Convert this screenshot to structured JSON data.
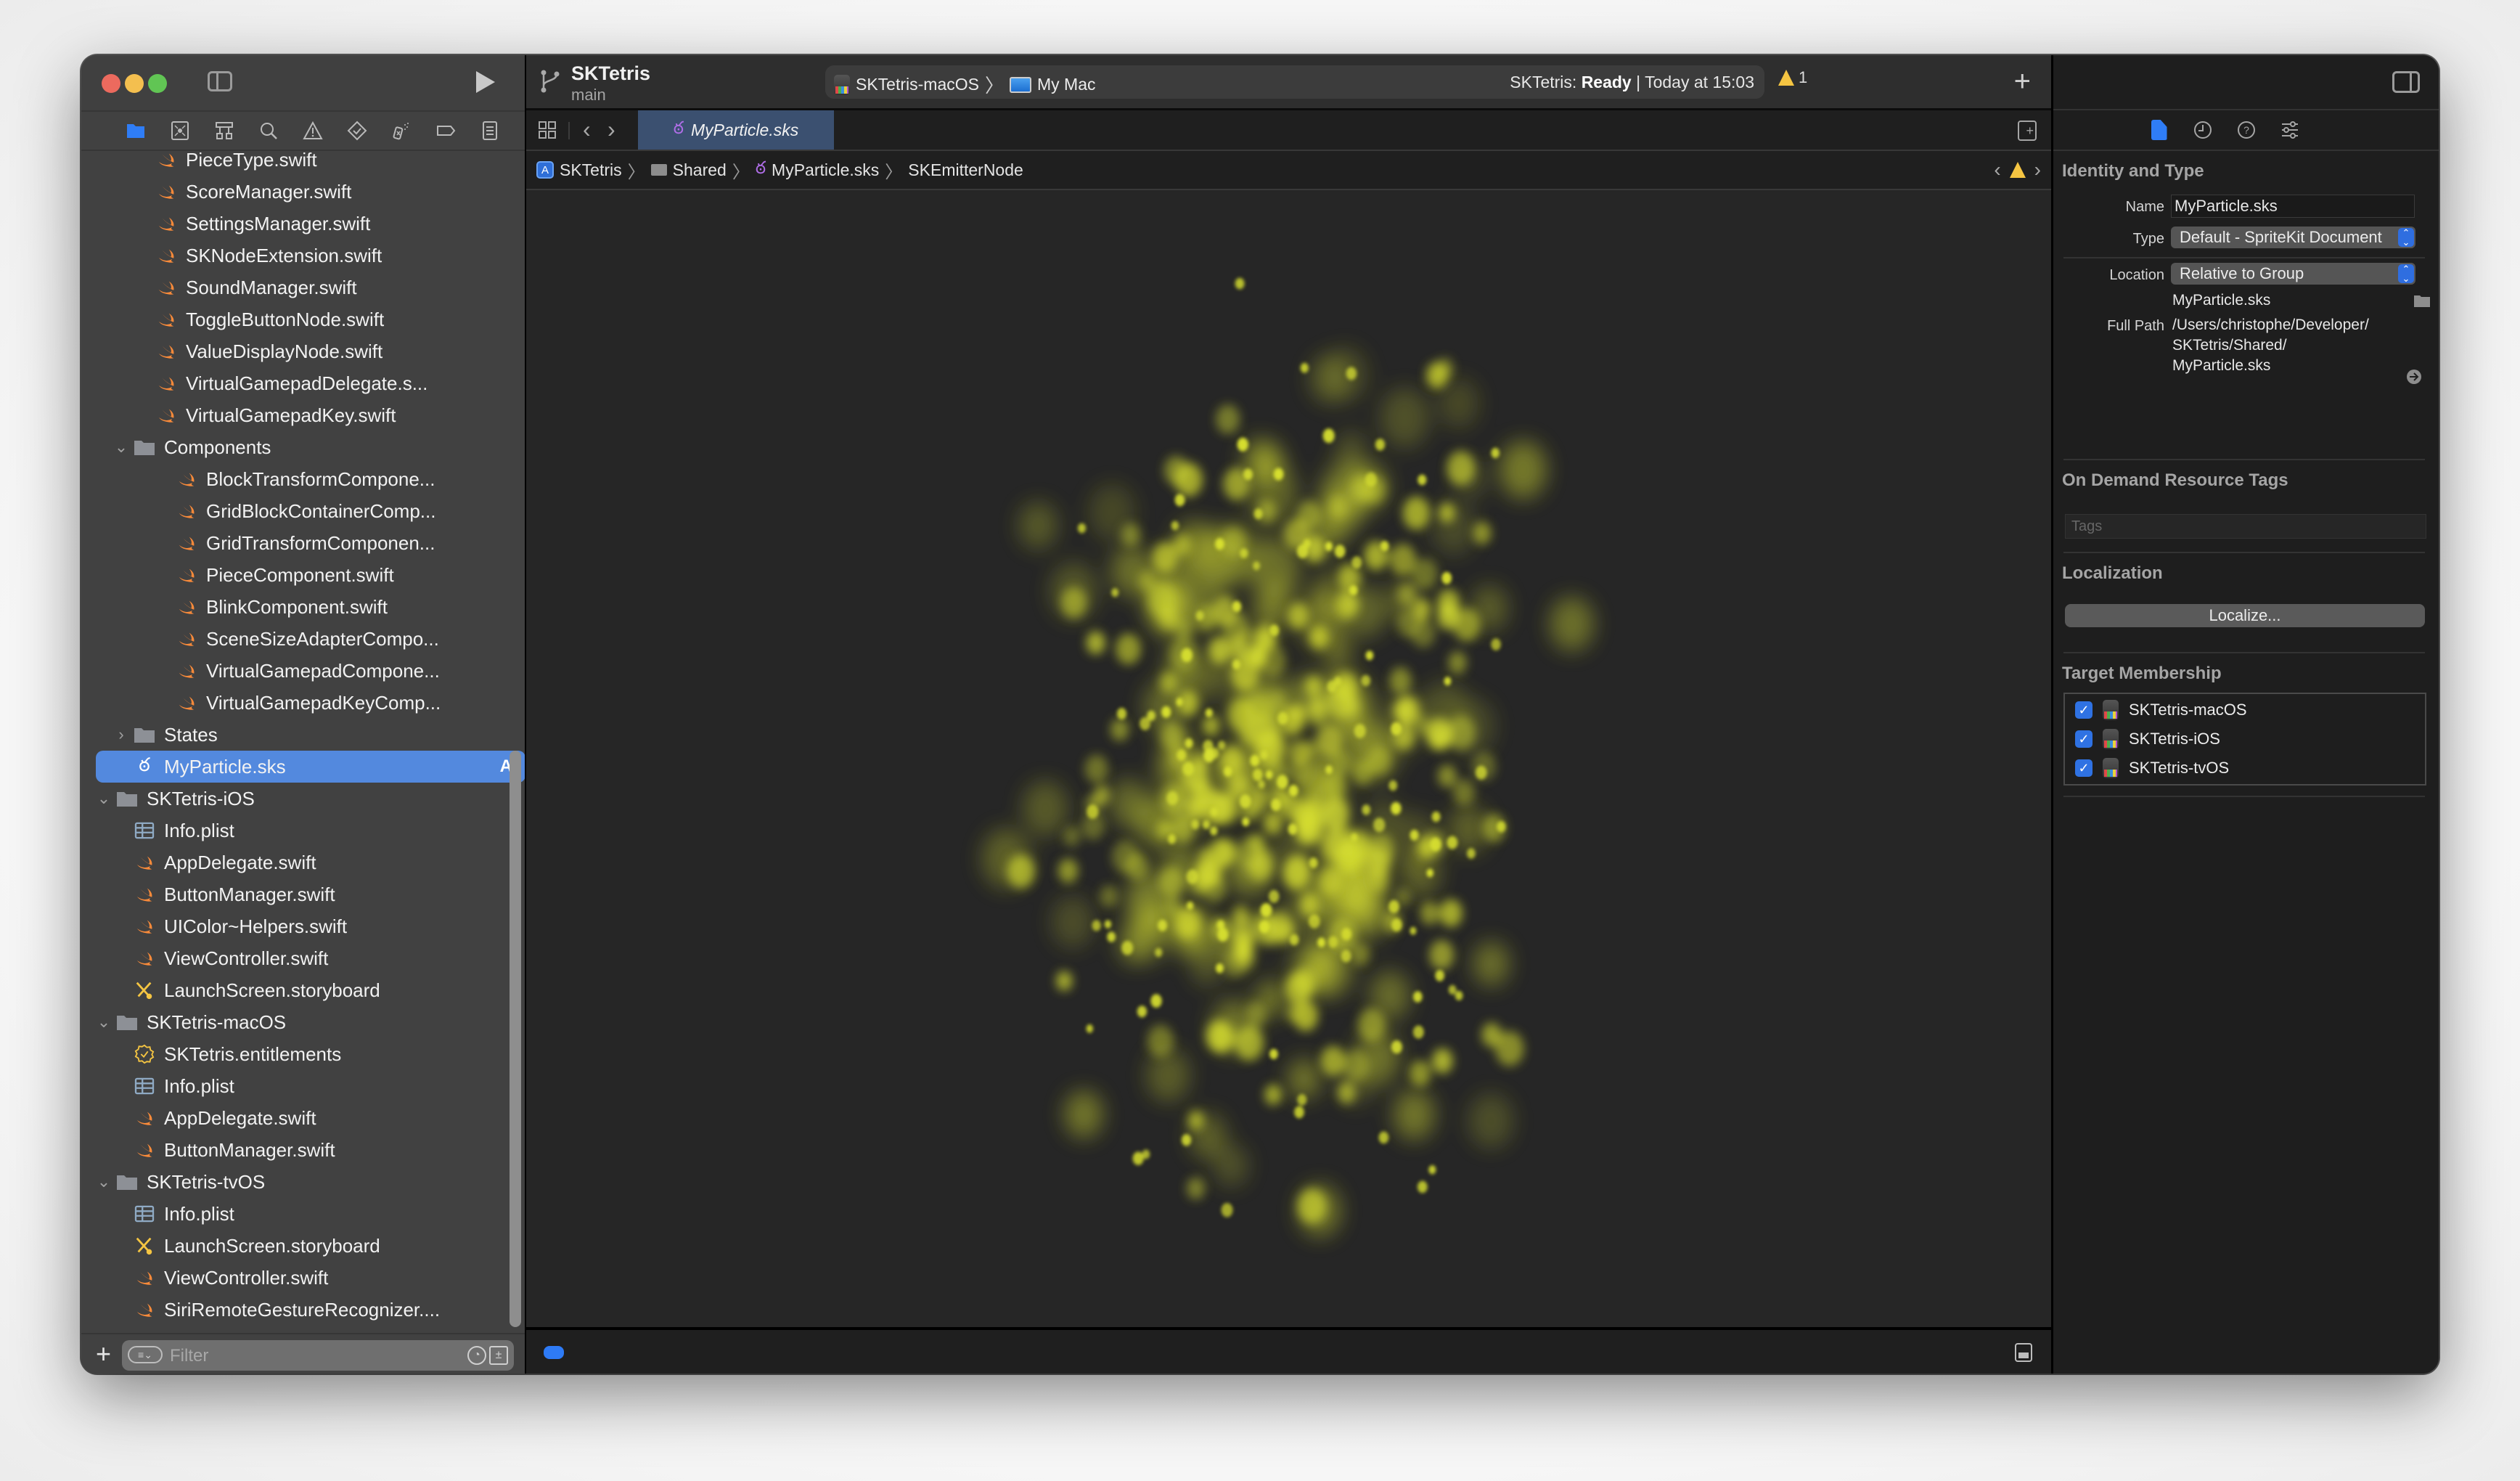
{
  "window": {
    "controls": [
      "close",
      "minimize",
      "zoom"
    ]
  },
  "toolbar": {
    "project_name": "SKTetris",
    "branch": "main",
    "scheme": "SKTetris-macOS",
    "destination": "My Mac",
    "status_project": "SKTetris:",
    "status_state": "Ready",
    "status_separator": "|",
    "status_time": "Today at 15:03",
    "warning_count": "1",
    "add_label": "+"
  },
  "navigator": {
    "tabs": [
      {
        "name": "project-navigator",
        "icon": "folder-icon",
        "active": true
      },
      {
        "name": "source-control-navigator",
        "icon": "source-control-icon"
      },
      {
        "name": "symbol-navigator",
        "icon": "hierarchy-icon"
      },
      {
        "name": "find-navigator",
        "icon": "search-icon"
      },
      {
        "name": "issue-navigator",
        "icon": "warning-icon"
      },
      {
        "name": "test-navigator",
        "icon": "diamond-check-icon"
      },
      {
        "name": "debug-navigator",
        "icon": "spray-icon"
      },
      {
        "name": "breakpoint-navigator",
        "icon": "breakpoint-icon"
      },
      {
        "name": "report-navigator",
        "icon": "list-icon"
      }
    ],
    "files": [
      {
        "label": "PieceType.swift",
        "type": "swift",
        "level": 3
      },
      {
        "label": "ScoreManager.swift",
        "type": "swift",
        "level": 3
      },
      {
        "label": "SettingsManager.swift",
        "type": "swift",
        "level": 3
      },
      {
        "label": "SKNodeExtension.swift",
        "type": "swift",
        "level": 3
      },
      {
        "label": "SoundManager.swift",
        "type": "swift",
        "level": 3
      },
      {
        "label": "ToggleButtonNode.swift",
        "type": "swift",
        "level": 3
      },
      {
        "label": "ValueDisplayNode.swift",
        "type": "swift",
        "level": 3
      },
      {
        "label": "VirtualGamepadDelegate.s...",
        "type": "swift",
        "level": 3
      },
      {
        "label": "VirtualGamepadKey.swift",
        "type": "swift",
        "level": 3
      },
      {
        "label": "Components",
        "type": "folder",
        "level": 2,
        "expanded": true
      },
      {
        "label": "BlockTransformCompone...",
        "type": "swift",
        "level": 4
      },
      {
        "label": "GridBlockContainerComp...",
        "type": "swift",
        "level": 4
      },
      {
        "label": "GridTransformComponen...",
        "type": "swift",
        "level": 4
      },
      {
        "label": "PieceComponent.swift",
        "type": "swift",
        "level": 4
      },
      {
        "label": "BlinkComponent.swift",
        "type": "swift",
        "level": 4
      },
      {
        "label": "SceneSizeAdapterCompo...",
        "type": "swift",
        "level": 4
      },
      {
        "label": "VirtualGamepadCompone...",
        "type": "swift",
        "level": 4
      },
      {
        "label": "VirtualGamepadKeyComp...",
        "type": "swift",
        "level": 4
      },
      {
        "label": "States",
        "type": "folder",
        "level": 2,
        "expanded": false
      },
      {
        "label": "MyParticle.sks",
        "type": "sks",
        "level": 2,
        "selected": true,
        "badge": "A"
      },
      {
        "label": "SKTetris-iOS",
        "type": "folder",
        "level": 1,
        "expanded": true
      },
      {
        "label": "Info.plist",
        "type": "plist",
        "level": 2
      },
      {
        "label": "AppDelegate.swift",
        "type": "swift",
        "level": 2
      },
      {
        "label": "ButtonManager.swift",
        "type": "swift",
        "level": 2
      },
      {
        "label": "UIColor~Helpers.swift",
        "type": "swift",
        "level": 2
      },
      {
        "label": "ViewController.swift",
        "type": "swift",
        "level": 2
      },
      {
        "label": "LaunchScreen.storyboard",
        "type": "storyboard",
        "level": 2
      },
      {
        "label": "SKTetris-macOS",
        "type": "folder",
        "level": 1,
        "expanded": true
      },
      {
        "label": "SKTetris.entitlements",
        "type": "entitlements",
        "level": 2
      },
      {
        "label": "Info.plist",
        "type": "plist",
        "level": 2
      },
      {
        "label": "AppDelegate.swift",
        "type": "swift",
        "level": 2
      },
      {
        "label": "ButtonManager.swift",
        "type": "swift",
        "level": 2
      },
      {
        "label": "SKTetris-tvOS",
        "type": "folder",
        "level": 1,
        "expanded": true
      },
      {
        "label": "Info.plist",
        "type": "plist",
        "level": 2
      },
      {
        "label": "LaunchScreen.storyboard",
        "type": "storyboard",
        "level": 2
      },
      {
        "label": "ViewController.swift",
        "type": "swift",
        "level": 2
      },
      {
        "label": "SiriRemoteGestureRecognizer....",
        "type": "swift",
        "level": 2
      }
    ],
    "filter_placeholder": "Filter"
  },
  "editor": {
    "tab_label": "MyParticle.sks",
    "breadcrumb": [
      "SKTetris",
      "Shared",
      "MyParticle.sks",
      "SKEmitterNode"
    ],
    "particle_color": "#d8e030",
    "canvas_bg": "#262626"
  },
  "inspector": {
    "tabs": [
      "file-inspector",
      "history-inspector",
      "quick-help-inspector",
      "attributes-inspector"
    ],
    "identity": {
      "title": "Identity and Type",
      "name_label": "Name",
      "name_value": "MyParticle.sks",
      "type_label": "Type",
      "type_value": "Default - SpriteKit Document",
      "location_label": "Location",
      "location_value": "Relative to Group",
      "location_file": "MyParticle.sks",
      "full_path_label": "Full Path",
      "full_path_lines": [
        "/Users/christophe/Developer/",
        "SKTetris/Shared/",
        "MyParticle.sks"
      ]
    },
    "odr": {
      "title": "On Demand Resource Tags",
      "tags_placeholder": "Tags"
    },
    "localization": {
      "title": "Localization",
      "button": "Localize..."
    },
    "targets": {
      "title": "Target Membership",
      "items": [
        {
          "label": "SKTetris-macOS",
          "checked": true
        },
        {
          "label": "SKTetris-iOS",
          "checked": true
        },
        {
          "label": "SKTetris-tvOS",
          "checked": true
        }
      ]
    }
  },
  "colors": {
    "accent": "#2f7df6",
    "selection": "#5389de",
    "swift_icon": "#f88a3a",
    "warning": "#f5c542",
    "sks_icon": "#b06ee8"
  }
}
